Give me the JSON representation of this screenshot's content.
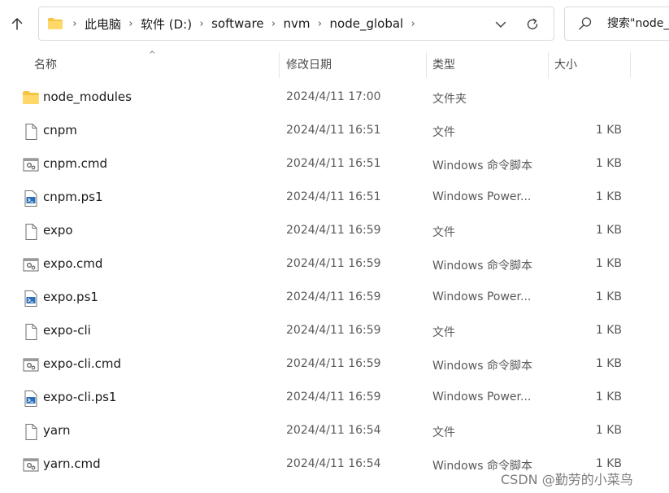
{
  "breadcrumbs": [
    "此电脑",
    "软件 (D:)",
    "software",
    "nvm",
    "node_global"
  ],
  "search": {
    "placeholder": "搜索\"node_global\""
  },
  "columns": {
    "name": "名称",
    "modified": "修改日期",
    "type": "类型",
    "size": "大小"
  },
  "files": [
    {
      "name": "node_modules",
      "modified": "2024/4/11 17:00",
      "type": "文件夹",
      "size": "",
      "icon": "folder-icon"
    },
    {
      "name": "cnpm",
      "modified": "2024/4/11 16:51",
      "type": "文件",
      "size": "1 KB",
      "icon": "file-icon"
    },
    {
      "name": "cnpm.cmd",
      "modified": "2024/4/11 16:51",
      "type": "Windows 命令脚本",
      "size": "1 KB",
      "icon": "cmd-script-icon"
    },
    {
      "name": "cnpm.ps1",
      "modified": "2024/4/11 16:51",
      "type": "Windows Power...",
      "size": "1 KB",
      "icon": "powershell-script-icon"
    },
    {
      "name": "expo",
      "modified": "2024/4/11 16:59",
      "type": "文件",
      "size": "1 KB",
      "icon": "file-icon"
    },
    {
      "name": "expo.cmd",
      "modified": "2024/4/11 16:59",
      "type": "Windows 命令脚本",
      "size": "1 KB",
      "icon": "cmd-script-icon"
    },
    {
      "name": "expo.ps1",
      "modified": "2024/4/11 16:59",
      "type": "Windows Power...",
      "size": "1 KB",
      "icon": "powershell-script-icon"
    },
    {
      "name": "expo-cli",
      "modified": "2024/4/11 16:59",
      "type": "文件",
      "size": "1 KB",
      "icon": "file-icon"
    },
    {
      "name": "expo-cli.cmd",
      "modified": "2024/4/11 16:59",
      "type": "Windows 命令脚本",
      "size": "1 KB",
      "icon": "cmd-script-icon"
    },
    {
      "name": "expo-cli.ps1",
      "modified": "2024/4/11 16:59",
      "type": "Windows Power...",
      "size": "1 KB",
      "icon": "powershell-script-icon"
    },
    {
      "name": "yarn",
      "modified": "2024/4/11 16:54",
      "type": "文件",
      "size": "1 KB",
      "icon": "file-icon"
    },
    {
      "name": "yarn.cmd",
      "modified": "2024/4/11 16:54",
      "type": "Windows 命令脚本",
      "size": "1 KB",
      "icon": "cmd-script-icon"
    }
  ],
  "watermark": "CSDN @勤劳的小菜鸟",
  "colors": {
    "folder": "#f5c542",
    "accent": "#0067c0"
  }
}
